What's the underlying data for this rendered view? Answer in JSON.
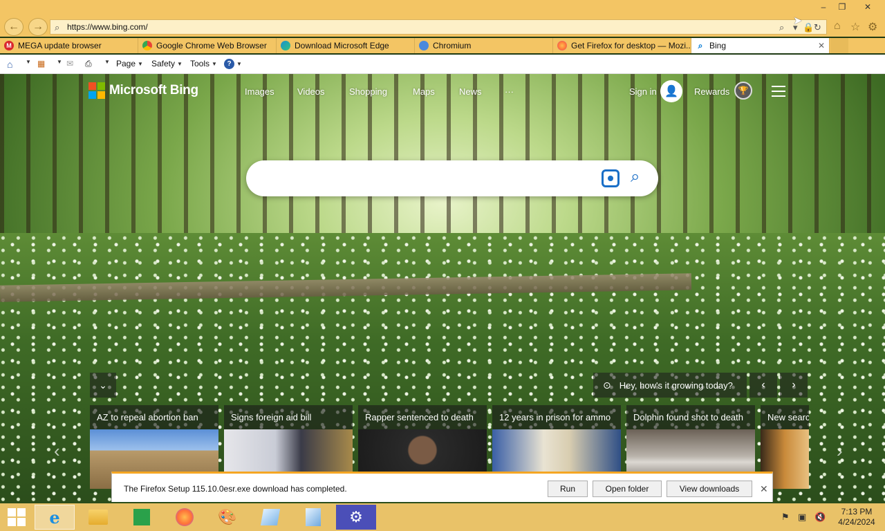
{
  "window": {
    "controls": {
      "minimize": "–",
      "restore": "❐",
      "close": "✕"
    }
  },
  "address_bar": {
    "url": "https://www.bing.com/",
    "icons": [
      "search-icon",
      "lock-icon",
      "refresh-icon"
    ]
  },
  "toolbar_right_icons": [
    "home-icon",
    "favorites-star-icon",
    "settings-gear-icon"
  ],
  "tabs": [
    {
      "label": "MEGA update browser",
      "icon": "mega-icon",
      "color": "#d9272e"
    },
    {
      "label": "Google Chrome Web Browser",
      "icon": "chrome-icon",
      "color": "#4285f4"
    },
    {
      "label": "Download Microsoft Edge",
      "icon": "edge-icon",
      "color": "#1a8fd0"
    },
    {
      "label": "Chromium",
      "icon": "chromium-icon",
      "color": "#4a89dc"
    },
    {
      "label": "Get Firefox for desktop — Mozi...",
      "icon": "firefox-icon",
      "color": "#ff7139"
    },
    {
      "label": "Bing",
      "icon": "bing-search-icon",
      "color": "#0078d4",
      "active": true
    }
  ],
  "command_bar": {
    "page": "Page",
    "safety": "Safety",
    "tools": "Tools"
  },
  "bing": {
    "brand": "Microsoft Bing",
    "nav": [
      "Images",
      "Videos",
      "Shopping",
      "Maps",
      "News",
      "···"
    ],
    "sign_in": "Sign in",
    "rewards": "Rewards",
    "search_placeholder": "",
    "pill_text": "Hey, how's it growing today?",
    "news": [
      {
        "title": "AZ to repeal abortion ban"
      },
      {
        "title": "Signs foreign aid bill"
      },
      {
        "title": "Rapper sentenced to death"
      },
      {
        "title": "12 years in prison for ammo"
      },
      {
        "title": "Dolphin found shot to death"
      },
      {
        "title": "New searcl"
      }
    ]
  },
  "download": {
    "message": "The Firefox Setup 115.10.0esr.exe download has completed.",
    "run": "Run",
    "open_folder": "Open folder",
    "view_downloads": "View downloads"
  },
  "taskbar": {
    "time": "7:13 PM",
    "date": "4/24/2024"
  },
  "colors": {
    "chrome_bar": "#f3c564",
    "accent_blue": "#1a6fc7",
    "download_border": "#f5a623"
  }
}
